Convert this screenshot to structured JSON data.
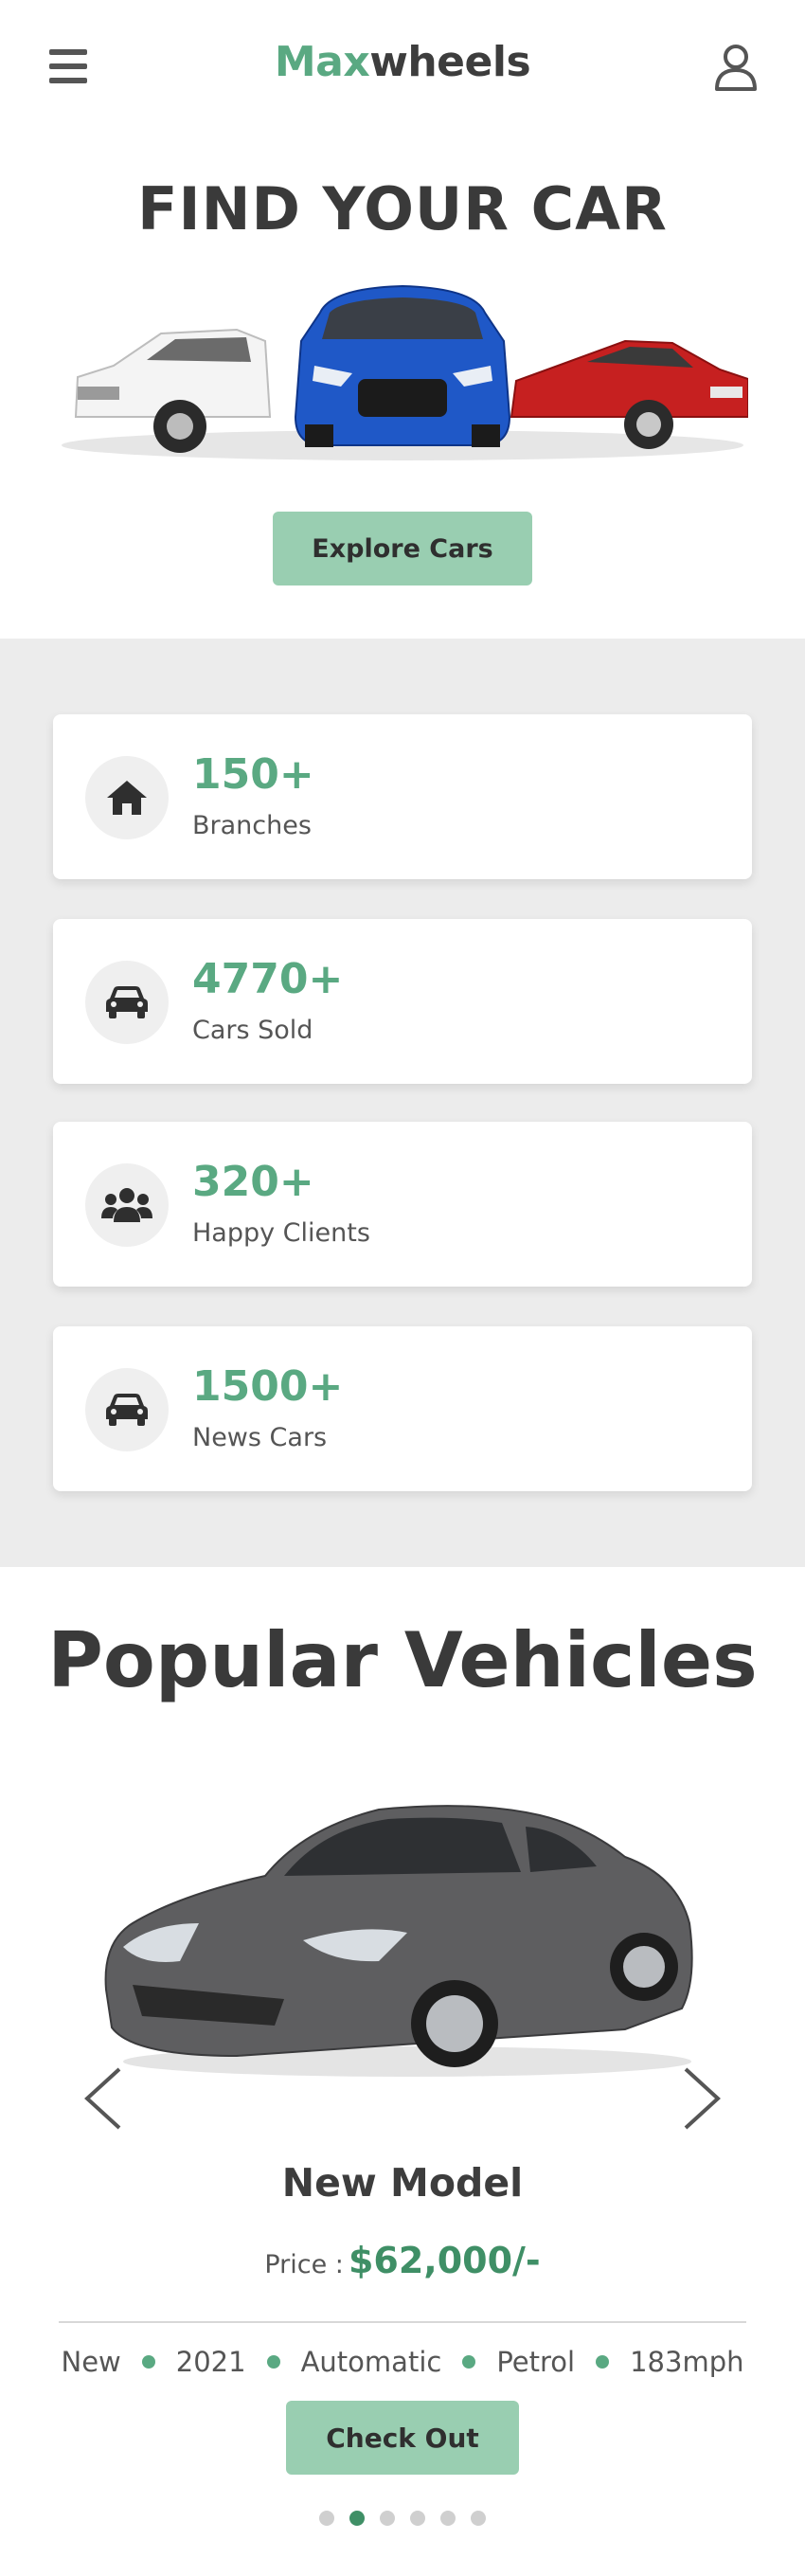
{
  "header": {
    "logo_part1": "Max",
    "logo_part2": "wheels",
    "menu_icon": "hamburger-icon",
    "user_icon": "user-icon"
  },
  "hero": {
    "title": "FIND YOUR CAR",
    "button_label": "Explore Cars"
  },
  "stats": [
    {
      "icon": "home-icon",
      "value": "150+",
      "label": "Branches"
    },
    {
      "icon": "car-icon",
      "value": "4770+",
      "label": "Cars Sold"
    },
    {
      "icon": "users-icon",
      "value": "320+",
      "label": "Happy Clients"
    },
    {
      "icon": "car-icon",
      "value": "1500+",
      "label": "News Cars"
    }
  ],
  "popular": {
    "title_part1": "Popular",
    "title_part2": "Vehicles",
    "model_name": "New Model",
    "price_label": "Price :",
    "price_value": "$62,000/-",
    "specs": [
      "New",
      "2021",
      "Automatic",
      "Petrol",
      "183mph"
    ],
    "button_label": "Check Out",
    "active_slide": 2,
    "slide_count": 6
  },
  "colors": {
    "brand": "#5aa982",
    "button": "#99ceb1",
    "price": "#3f8f66",
    "stats_bg": "#ececec"
  }
}
